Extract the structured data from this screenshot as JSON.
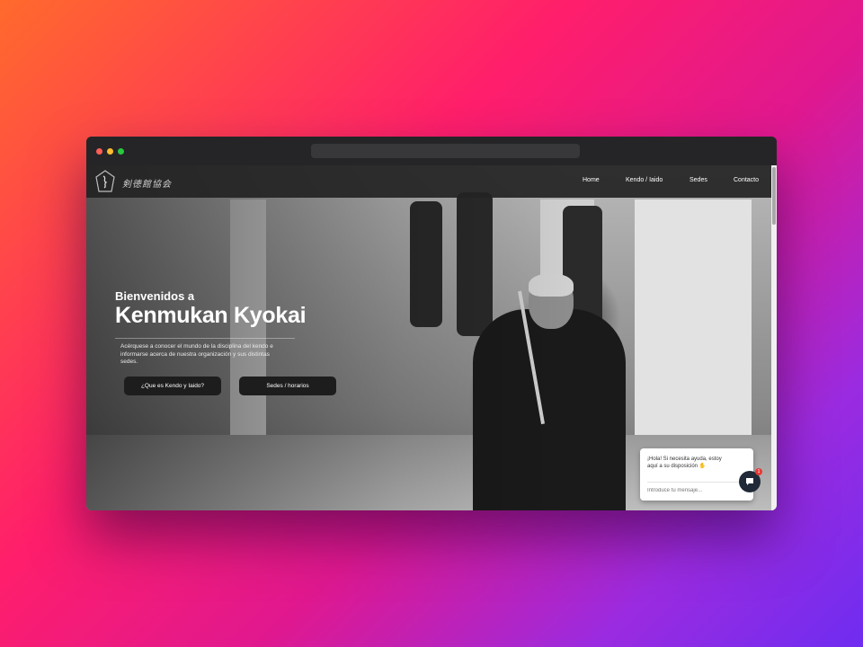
{
  "browser": {
    "url": ""
  },
  "nav": {
    "items": [
      "Home",
      "Kendo / Iaido",
      "Sedes",
      "Contacto"
    ]
  },
  "hero": {
    "subtitle": "Bienvenidos a",
    "title": "Kenmukan Kyokai",
    "description": "Acérquese a conocer el mundo de la disciplina del kendo e informarse acerca de nuestra organización y sus distintas sedes.",
    "buttons": [
      "¿Que es Kendo y Iaido?",
      "Sedes / horarios"
    ]
  },
  "chat": {
    "message": "¡Hola! Si necesita ayuda, estoy aquí a su disposición ✋",
    "input_placeholder": "Introduce tu mensaje...",
    "badge_count": "1"
  },
  "colors": {
    "nav_bg": "#232323",
    "button_bg": "#1d1d1d",
    "badge": "#e53935",
    "chat_fab": "#1f2937"
  }
}
